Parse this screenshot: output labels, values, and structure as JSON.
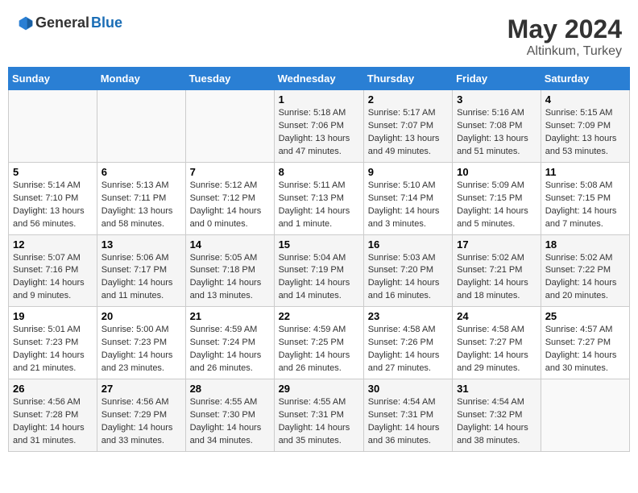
{
  "header": {
    "logo_general": "General",
    "logo_blue": "Blue",
    "month_year": "May 2024",
    "location": "Altinkum, Turkey"
  },
  "weekdays": [
    "Sunday",
    "Monday",
    "Tuesday",
    "Wednesday",
    "Thursday",
    "Friday",
    "Saturday"
  ],
  "weeks": [
    [
      {
        "day": "",
        "sunrise": "",
        "sunset": "",
        "daylight": ""
      },
      {
        "day": "",
        "sunrise": "",
        "sunset": "",
        "daylight": ""
      },
      {
        "day": "",
        "sunrise": "",
        "sunset": "",
        "daylight": ""
      },
      {
        "day": "1",
        "sunrise": "Sunrise: 5:18 AM",
        "sunset": "Sunset: 7:06 PM",
        "daylight": "Daylight: 13 hours and 47 minutes."
      },
      {
        "day": "2",
        "sunrise": "Sunrise: 5:17 AM",
        "sunset": "Sunset: 7:07 PM",
        "daylight": "Daylight: 13 hours and 49 minutes."
      },
      {
        "day": "3",
        "sunrise": "Sunrise: 5:16 AM",
        "sunset": "Sunset: 7:08 PM",
        "daylight": "Daylight: 13 hours and 51 minutes."
      },
      {
        "day": "4",
        "sunrise": "Sunrise: 5:15 AM",
        "sunset": "Sunset: 7:09 PM",
        "daylight": "Daylight: 13 hours and 53 minutes."
      }
    ],
    [
      {
        "day": "5",
        "sunrise": "Sunrise: 5:14 AM",
        "sunset": "Sunset: 7:10 PM",
        "daylight": "Daylight: 13 hours and 56 minutes."
      },
      {
        "day": "6",
        "sunrise": "Sunrise: 5:13 AM",
        "sunset": "Sunset: 7:11 PM",
        "daylight": "Daylight: 13 hours and 58 minutes."
      },
      {
        "day": "7",
        "sunrise": "Sunrise: 5:12 AM",
        "sunset": "Sunset: 7:12 PM",
        "daylight": "Daylight: 14 hours and 0 minutes."
      },
      {
        "day": "8",
        "sunrise": "Sunrise: 5:11 AM",
        "sunset": "Sunset: 7:13 PM",
        "daylight": "Daylight: 14 hours and 1 minute."
      },
      {
        "day": "9",
        "sunrise": "Sunrise: 5:10 AM",
        "sunset": "Sunset: 7:14 PM",
        "daylight": "Daylight: 14 hours and 3 minutes."
      },
      {
        "day": "10",
        "sunrise": "Sunrise: 5:09 AM",
        "sunset": "Sunset: 7:15 PM",
        "daylight": "Daylight: 14 hours and 5 minutes."
      },
      {
        "day": "11",
        "sunrise": "Sunrise: 5:08 AM",
        "sunset": "Sunset: 7:15 PM",
        "daylight": "Daylight: 14 hours and 7 minutes."
      }
    ],
    [
      {
        "day": "12",
        "sunrise": "Sunrise: 5:07 AM",
        "sunset": "Sunset: 7:16 PM",
        "daylight": "Daylight: 14 hours and 9 minutes."
      },
      {
        "day": "13",
        "sunrise": "Sunrise: 5:06 AM",
        "sunset": "Sunset: 7:17 PM",
        "daylight": "Daylight: 14 hours and 11 minutes."
      },
      {
        "day": "14",
        "sunrise": "Sunrise: 5:05 AM",
        "sunset": "Sunset: 7:18 PM",
        "daylight": "Daylight: 14 hours and 13 minutes."
      },
      {
        "day": "15",
        "sunrise": "Sunrise: 5:04 AM",
        "sunset": "Sunset: 7:19 PM",
        "daylight": "Daylight: 14 hours and 14 minutes."
      },
      {
        "day": "16",
        "sunrise": "Sunrise: 5:03 AM",
        "sunset": "Sunset: 7:20 PM",
        "daylight": "Daylight: 14 hours and 16 minutes."
      },
      {
        "day": "17",
        "sunrise": "Sunrise: 5:02 AM",
        "sunset": "Sunset: 7:21 PM",
        "daylight": "Daylight: 14 hours and 18 minutes."
      },
      {
        "day": "18",
        "sunrise": "Sunrise: 5:02 AM",
        "sunset": "Sunset: 7:22 PM",
        "daylight": "Daylight: 14 hours and 20 minutes."
      }
    ],
    [
      {
        "day": "19",
        "sunrise": "Sunrise: 5:01 AM",
        "sunset": "Sunset: 7:23 PM",
        "daylight": "Daylight: 14 hours and 21 minutes."
      },
      {
        "day": "20",
        "sunrise": "Sunrise: 5:00 AM",
        "sunset": "Sunset: 7:23 PM",
        "daylight": "Daylight: 14 hours and 23 minutes."
      },
      {
        "day": "21",
        "sunrise": "Sunrise: 4:59 AM",
        "sunset": "Sunset: 7:24 PM",
        "daylight": "Daylight: 14 hours and 26 minutes."
      },
      {
        "day": "22",
        "sunrise": "Sunrise: 4:59 AM",
        "sunset": "Sunset: 7:25 PM",
        "daylight": "Daylight: 14 hours and 26 minutes."
      },
      {
        "day": "23",
        "sunrise": "Sunrise: 4:58 AM",
        "sunset": "Sunset: 7:26 PM",
        "daylight": "Daylight: 14 hours and 27 minutes."
      },
      {
        "day": "24",
        "sunrise": "Sunrise: 4:58 AM",
        "sunset": "Sunset: 7:27 PM",
        "daylight": "Daylight: 14 hours and 29 minutes."
      },
      {
        "day": "25",
        "sunrise": "Sunrise: 4:57 AM",
        "sunset": "Sunset: 7:27 PM",
        "daylight": "Daylight: 14 hours and 30 minutes."
      }
    ],
    [
      {
        "day": "26",
        "sunrise": "Sunrise: 4:56 AM",
        "sunset": "Sunset: 7:28 PM",
        "daylight": "Daylight: 14 hours and 31 minutes."
      },
      {
        "day": "27",
        "sunrise": "Sunrise: 4:56 AM",
        "sunset": "Sunset: 7:29 PM",
        "daylight": "Daylight: 14 hours and 33 minutes."
      },
      {
        "day": "28",
        "sunrise": "Sunrise: 4:55 AM",
        "sunset": "Sunset: 7:30 PM",
        "daylight": "Daylight: 14 hours and 34 minutes."
      },
      {
        "day": "29",
        "sunrise": "Sunrise: 4:55 AM",
        "sunset": "Sunset: 7:31 PM",
        "daylight": "Daylight: 14 hours and 35 minutes."
      },
      {
        "day": "30",
        "sunrise": "Sunrise: 4:54 AM",
        "sunset": "Sunset: 7:31 PM",
        "daylight": "Daylight: 14 hours and 36 minutes."
      },
      {
        "day": "31",
        "sunrise": "Sunrise: 4:54 AM",
        "sunset": "Sunset: 7:32 PM",
        "daylight": "Daylight: 14 hours and 38 minutes."
      },
      {
        "day": "",
        "sunrise": "",
        "sunset": "",
        "daylight": ""
      }
    ]
  ]
}
